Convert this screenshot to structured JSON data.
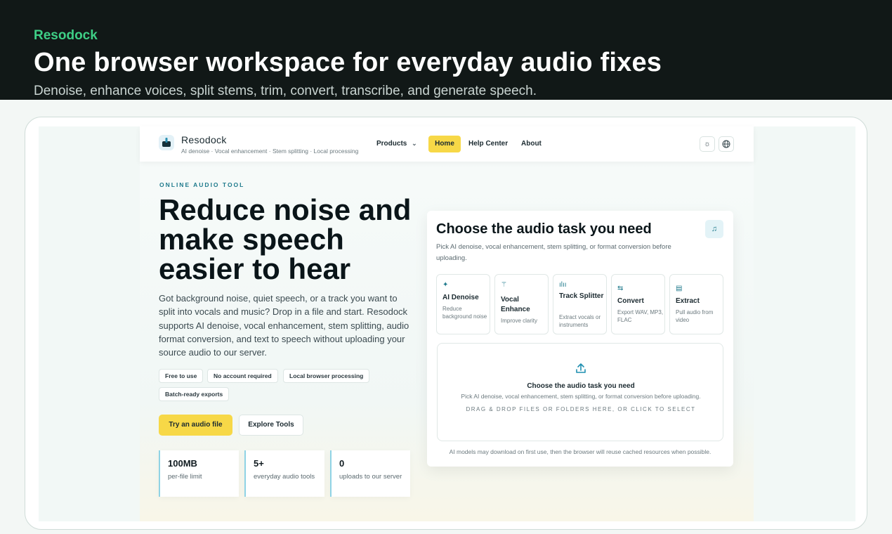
{
  "banner": {
    "brand": "Resodock",
    "headline": "One browser workspace for everyday audio fixes",
    "subheadline": "Denoise, enhance voices, split stems, trim, convert, transcribe, and generate speech."
  },
  "nav": {
    "site_name": "Resodock",
    "tagline": "AI denoise · Vocal enhancement · Stem splitting · Local processing",
    "products": "Products",
    "home": "Home",
    "help": "Help Center",
    "about": "About",
    "theme_icon": "sun-icon",
    "language_icon": "globe-icon"
  },
  "hero": {
    "eyebrow": "ONLINE AUDIO TOOL",
    "title": "Reduce noise and make speech easier to hear",
    "description": "Got background noise, quiet speech, or a track you want to split into vocals and music? Drop in a file and start. Resodock supports AI denoise, vocal enhancement, stem splitting, audio format conversion, and text to speech without uploading your source audio to our server.",
    "chips": [
      "Free to use",
      "No account required",
      "Local browser processing",
      "Batch-ready exports"
    ],
    "primary_cta": "Try an audio file",
    "secondary_cta": "Explore Tools",
    "stats": [
      {
        "value": "100MB",
        "label": "per-file limit"
      },
      {
        "value": "5+",
        "label": "everyday audio tools"
      },
      {
        "value": "0",
        "label": "uploads to our server"
      }
    ]
  },
  "task_card": {
    "title": "Choose the audio task you need",
    "subtitle": "Pick AI denoise, vocal enhancement, stem splitting, or format conversion before uploading.",
    "tools": [
      {
        "name": "AI Denoise",
        "desc": "Reduce background noise",
        "icon": "sparkles-icon"
      },
      {
        "name": "Vocal Enhance",
        "desc": "Improve clarity",
        "icon": "wand-icon"
      },
      {
        "name": "Track Splitter",
        "desc": "Extract vocals or instruments",
        "icon": "waveform-icon"
      },
      {
        "name": "Convert",
        "desc": "Export WAV, MP3, FLAC",
        "icon": "swap-icon"
      },
      {
        "name": "Extract",
        "desc": "Pull audio from video",
        "icon": "file-audio-icon"
      }
    ],
    "drop": {
      "title": "Choose the audio task you need",
      "subtitle": "Pick AI denoise, vocal enhancement, stem splitting, or format conversion before uploading.",
      "hint": "DRAG & DROP FILES OR FOLDERS HERE, OR CLICK TO SELECT"
    },
    "footnote": "AI models may download on first use, then the browser will reuse cached resources when possible."
  }
}
